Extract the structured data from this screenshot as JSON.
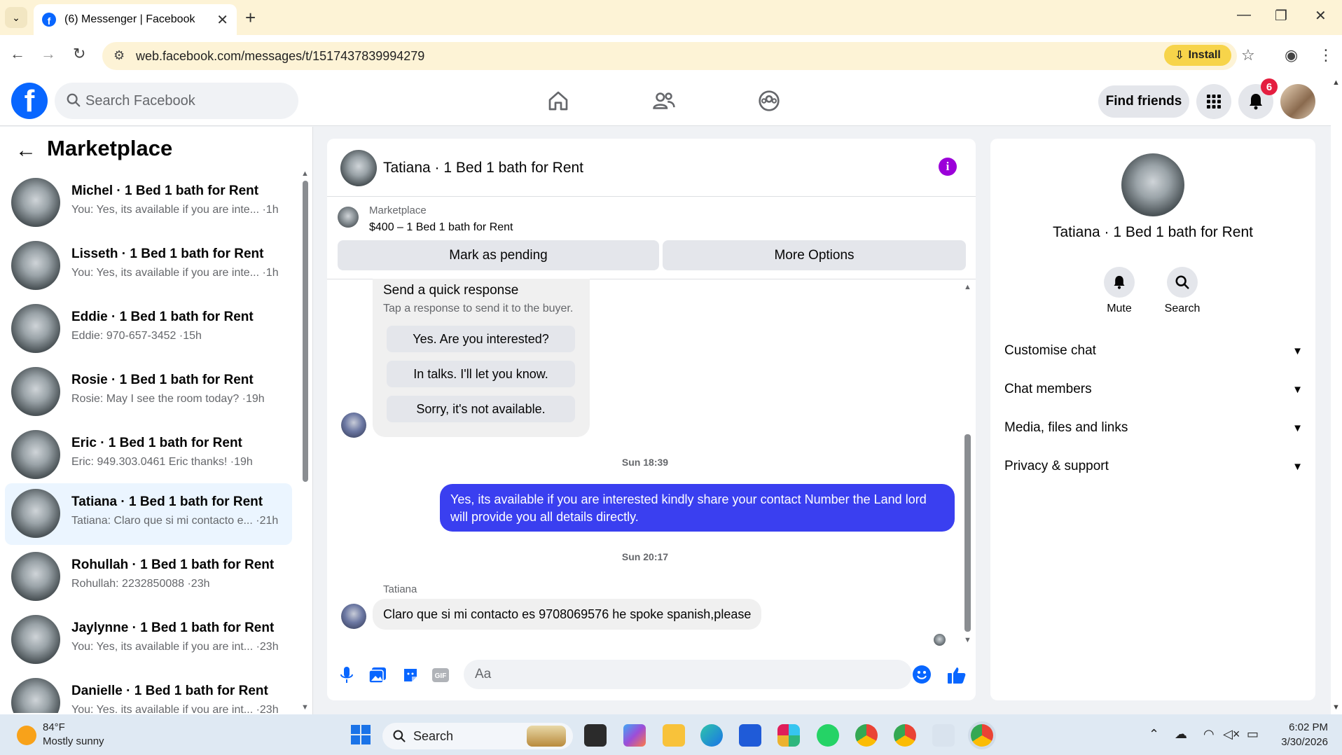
{
  "browser": {
    "tab_title": "(6) Messenger | Facebook",
    "url": "web.facebook.com/messages/t/1517437839994279",
    "install_label": "Install"
  },
  "header": {
    "search_placeholder": "Search Facebook",
    "find_friends_label": "Find friends",
    "notification_count": "6"
  },
  "sidebar": {
    "title": "Marketplace",
    "conversations": [
      {
        "name": "Michel · 1 Bed 1 bath for Rent",
        "snippet": "You: Yes, its available if you are inte... ·1h",
        "active": false
      },
      {
        "name": "Lisseth · 1 Bed 1 bath for Rent",
        "snippet": "You: Yes, its available if you are inte... ·1h",
        "active": false
      },
      {
        "name": "Eddie · 1 Bed 1 bath for Rent",
        "snippet": "Eddie: 970-657-3452 ·15h",
        "active": false
      },
      {
        "name": "Rosie · 1 Bed 1 bath for Rent",
        "snippet": "Rosie: May I see the room today? ·19h",
        "active": false
      },
      {
        "name": "Eric · 1 Bed 1 bath for Rent",
        "snippet": "Eric: 949.303.0461 Eric thanks! ·19h",
        "active": false
      },
      {
        "name": "Tatiana · 1 Bed 1 bath for Rent",
        "snippet": "Tatiana: Claro que si mi contacto e... ·21h",
        "active": true
      },
      {
        "name": "Rohullah · 1 Bed 1 bath for Rent",
        "snippet": "Rohullah: 2232850088 ·23h",
        "active": false
      },
      {
        "name": "Jaylynne · 1 Bed 1 bath for Rent",
        "snippet": "You: Yes, its available if you are int... ·23h",
        "active": false
      },
      {
        "name": "Danielle · 1 Bed 1 bath for Rent",
        "snippet": "You: Yes, its available if you are int... ·23h",
        "active": false
      }
    ]
  },
  "chat": {
    "title": "Tatiana · 1 Bed 1 bath for Rent",
    "marketplace_label": "Marketplace",
    "listing": "$400 – 1 Bed 1 bath for Rent",
    "mark_pending_label": "Mark as pending",
    "more_options_label": "More Options",
    "quick_response_title": "Send a quick response",
    "quick_response_sub": "Tap a response to send it to the buyer.",
    "quick_responses": [
      "Yes. Are you interested?",
      "In talks. I'll let you know.",
      "Sorry, it's not available."
    ],
    "timestamp1": "Sun 18:39",
    "outgoing_message": "Yes, its available if you are interested kindly share your contact Number the Land lord will provide you all details directly.",
    "timestamp2": "Sun 20:17",
    "sender_name": "Tatiana",
    "incoming_message": "Claro que si mi contacto es 9708069576 he spoke spanish,please",
    "composer_placeholder": "Aa"
  },
  "details": {
    "title": "Tatiana · 1 Bed 1 bath for Rent",
    "mute_label": "Mute",
    "search_label": "Search",
    "rows": [
      "Customise chat",
      "Chat members",
      "Media, files and links",
      "Privacy & support"
    ]
  },
  "taskbar": {
    "temperature": "84°F",
    "weather": "Mostly sunny",
    "search_label": "Search",
    "time": "6:02 PM",
    "date": "3/30/2026"
  },
  "colors": {
    "accent": "#0866ff",
    "outgoing_bubble": "#3a3ff0",
    "info": "#9b00d9",
    "notification": "#e41e3f"
  }
}
